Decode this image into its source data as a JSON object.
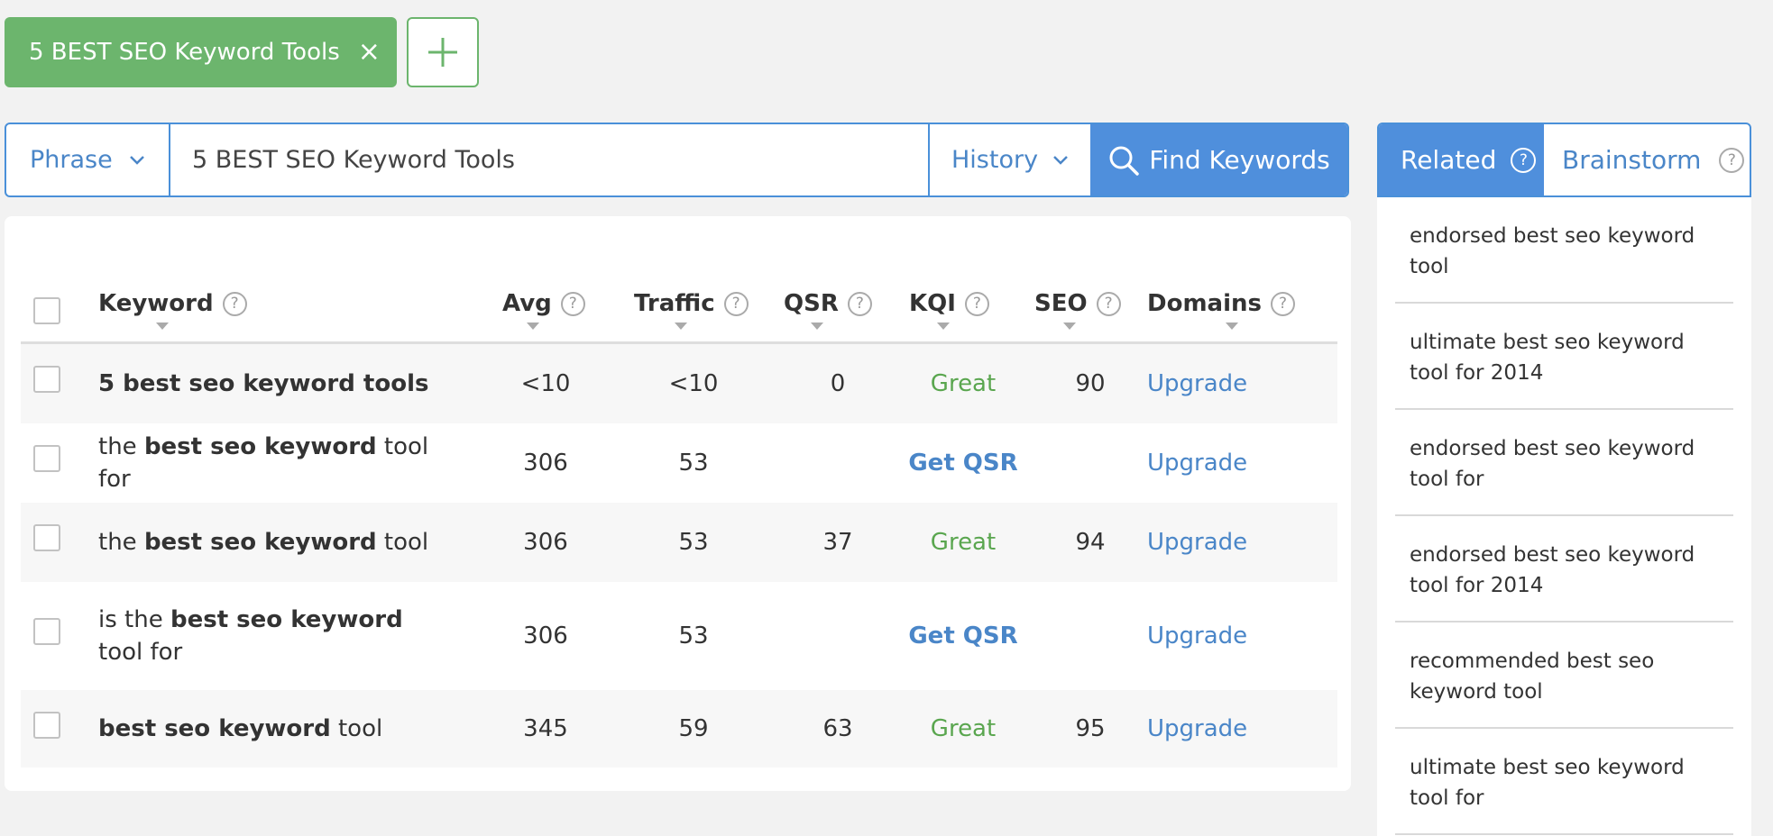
{
  "tab": {
    "label": "5 BEST SEO Keyword Tools",
    "close": "×"
  },
  "search": {
    "mode": "Phrase",
    "query": "5 BEST SEO Keyword Tools",
    "history": "History",
    "find_label": "Find Keywords"
  },
  "table": {
    "headers": {
      "keyword": "Keyword",
      "avg": "Avg",
      "traffic": "Traffic",
      "qsr": "QSR",
      "kqi": "KQI",
      "seo": "SEO",
      "domains": "Domains"
    },
    "help": "?",
    "rows": [
      {
        "kw_pre": "",
        "kw_bold": "5 best seo keyword tools",
        "kw_post": "",
        "avg": "<10",
        "traffic": "<10",
        "qsr": "0",
        "kqi": "Great",
        "kqi_type": "great",
        "seo": "90",
        "domains": "Upgrade"
      },
      {
        "kw_pre": "the ",
        "kw_bold": "best seo keyword",
        "kw_post": " tool for",
        "avg": "306",
        "traffic": "53",
        "qsr": "",
        "kqi": "Get QSR",
        "kqi_type": "getqsr",
        "seo": "",
        "domains": "Upgrade"
      },
      {
        "kw_pre": "the ",
        "kw_bold": "best seo keyword",
        "kw_post": " tool",
        "avg": "306",
        "traffic": "53",
        "qsr": "37",
        "kqi": "Great",
        "kqi_type": "great",
        "seo": "94",
        "domains": "Upgrade"
      },
      {
        "kw_pre": "is the ",
        "kw_bold": "best seo keyword",
        "kw_post": " tool for",
        "avg": "306",
        "traffic": "53",
        "qsr": "",
        "kqi": "Get QSR",
        "kqi_type": "getqsr",
        "seo": "",
        "domains": "Upgrade"
      },
      {
        "kw_pre": "",
        "kw_bold": "best seo keyword",
        "kw_post": " tool",
        "avg": "345",
        "traffic": "59",
        "qsr": "63",
        "kqi": "Great",
        "kqi_type": "great",
        "seo": "95",
        "domains": "Upgrade"
      }
    ]
  },
  "panel": {
    "tabs": {
      "related": "Related",
      "brainstorm": "Brainstorm"
    },
    "help": "?",
    "items": [
      "endorsed best seo keyword tool",
      "ultimate best seo keyword tool for 2014",
      "endorsed best seo keyword tool for",
      "endorsed best seo keyword tool for 2014",
      "recommended best seo keyword tool",
      "ultimate best seo keyword tool for"
    ]
  },
  "colors": {
    "green": "#6cb56d",
    "blue": "#4f8fdc",
    "link_blue": "#4a86c8",
    "great_green": "#5aa64f"
  },
  "icons": {
    "close": "close-icon",
    "add": "plus-icon",
    "dropdown": "chevron-down-icon",
    "search": "search-icon",
    "help": "help-icon"
  }
}
